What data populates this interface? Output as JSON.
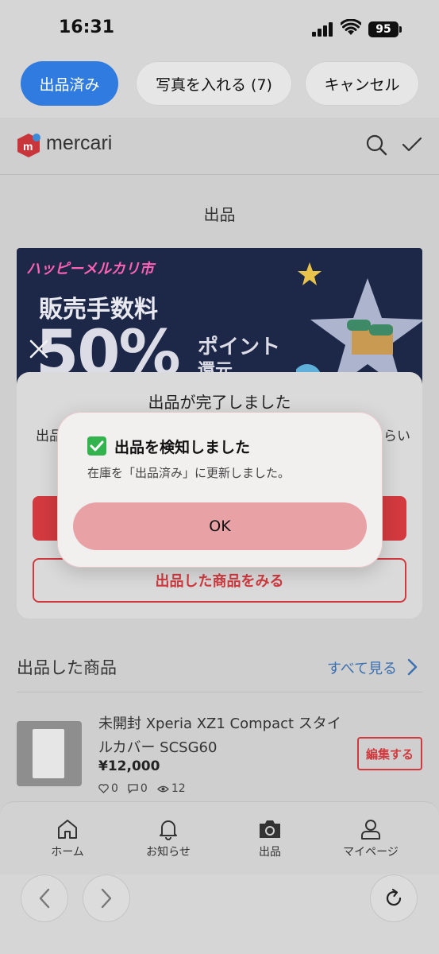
{
  "status_bar": {
    "time": "16:31",
    "battery": "95"
  },
  "top_actions": {
    "listed_label": "出品済み",
    "add_photos_label": "写真を入れる (7)",
    "cancel_label": "キャンセル"
  },
  "app": {
    "logo_text": "mercari",
    "page_title": "出品",
    "banner": {
      "tag": "ハッピーメルカリ市",
      "line1": "販売手数料",
      "big": "50%",
      "small1": "ポイント",
      "small2": "還元"
    },
    "sheet": {
      "title": "出品が完了しました",
      "text_left": "出品",
      "text_right": "らい",
      "outline_button": "出品した商品をみる"
    },
    "listings": {
      "section_title": "出品した商品",
      "see_all": "すべて見る",
      "item": {
        "title": "未開封 Xperia XZ1 Compact スタイルカバー SCSG60",
        "price": "¥12,000",
        "likes": "0",
        "comments": "0",
        "views": "12",
        "edit_label": "編集する"
      }
    },
    "bottom_nav": [
      {
        "label": "ホーム",
        "icon": "home-icon"
      },
      {
        "label": "お知らせ",
        "icon": "bell-icon"
      },
      {
        "label": "出品",
        "icon": "camera-icon"
      },
      {
        "label": "マイページ",
        "icon": "person-icon"
      }
    ]
  },
  "alert": {
    "title": "出品を検知しました",
    "message": "在庫を「出品済み」に更新しました。",
    "ok_label": "OK"
  },
  "colors": {
    "primary_blue": "#2f7be0",
    "mercari_red": "#d33a3f",
    "link_blue": "#3a6fb0",
    "check_green": "#33b34d"
  }
}
